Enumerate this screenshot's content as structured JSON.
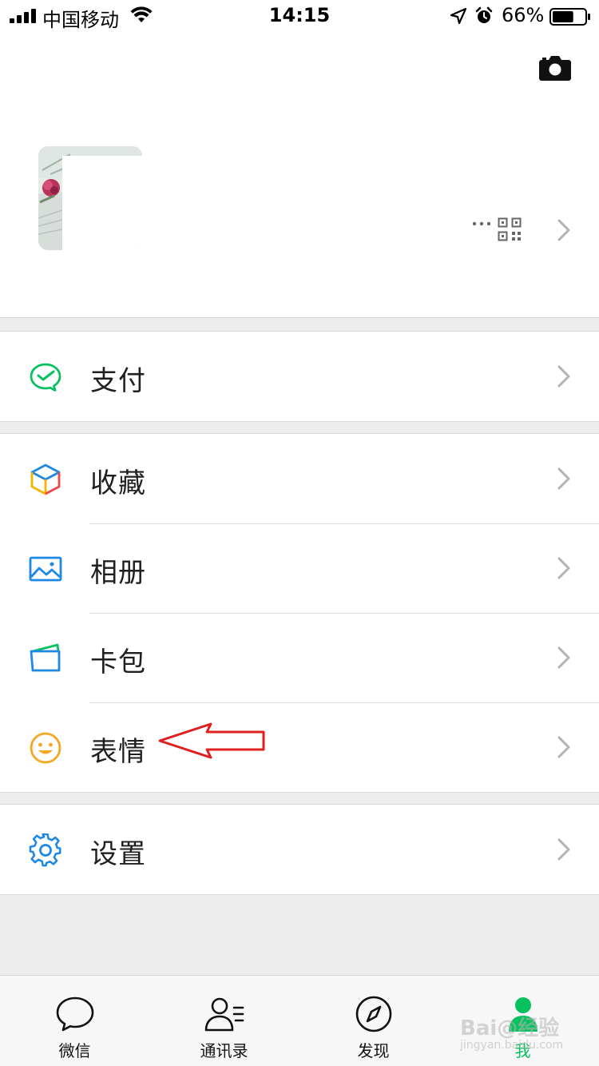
{
  "status_bar": {
    "carrier": "中国移动",
    "time": "14:15",
    "battery": "66%",
    "battery_level": 0.66
  },
  "profile": {
    "more_text": "..."
  },
  "menu": {
    "group1": [
      {
        "label": "支付",
        "icon": "wechat-pay-icon",
        "color": "#07c160"
      }
    ],
    "group2": [
      {
        "label": "收藏",
        "icon": "favorites-cube-icon"
      },
      {
        "label": "相册",
        "icon": "album-image-icon",
        "color": "#1e88e5"
      },
      {
        "label": "卡包",
        "icon": "card-wallet-icon"
      },
      {
        "label": "表情",
        "icon": "sticker-smiley-icon",
        "color": "#f5a623"
      }
    ],
    "group3": [
      {
        "label": "设置",
        "icon": "settings-gear-icon",
        "color": "#1e88e5"
      }
    ]
  },
  "tabs": [
    {
      "label": "微信",
      "icon": "chat-bubble-icon",
      "active": false
    },
    {
      "label": "通讯录",
      "icon": "contacts-icon",
      "active": false
    },
    {
      "label": "发现",
      "icon": "compass-icon",
      "active": false
    },
    {
      "label": "我",
      "icon": "me-person-icon",
      "active": true
    }
  ],
  "watermark": {
    "text": "Bai@经验",
    "sub": "jingyan.baidu.com"
  },
  "colors": {
    "accent": "#07c160",
    "background": "#ededed",
    "annotation": "#e02020"
  }
}
